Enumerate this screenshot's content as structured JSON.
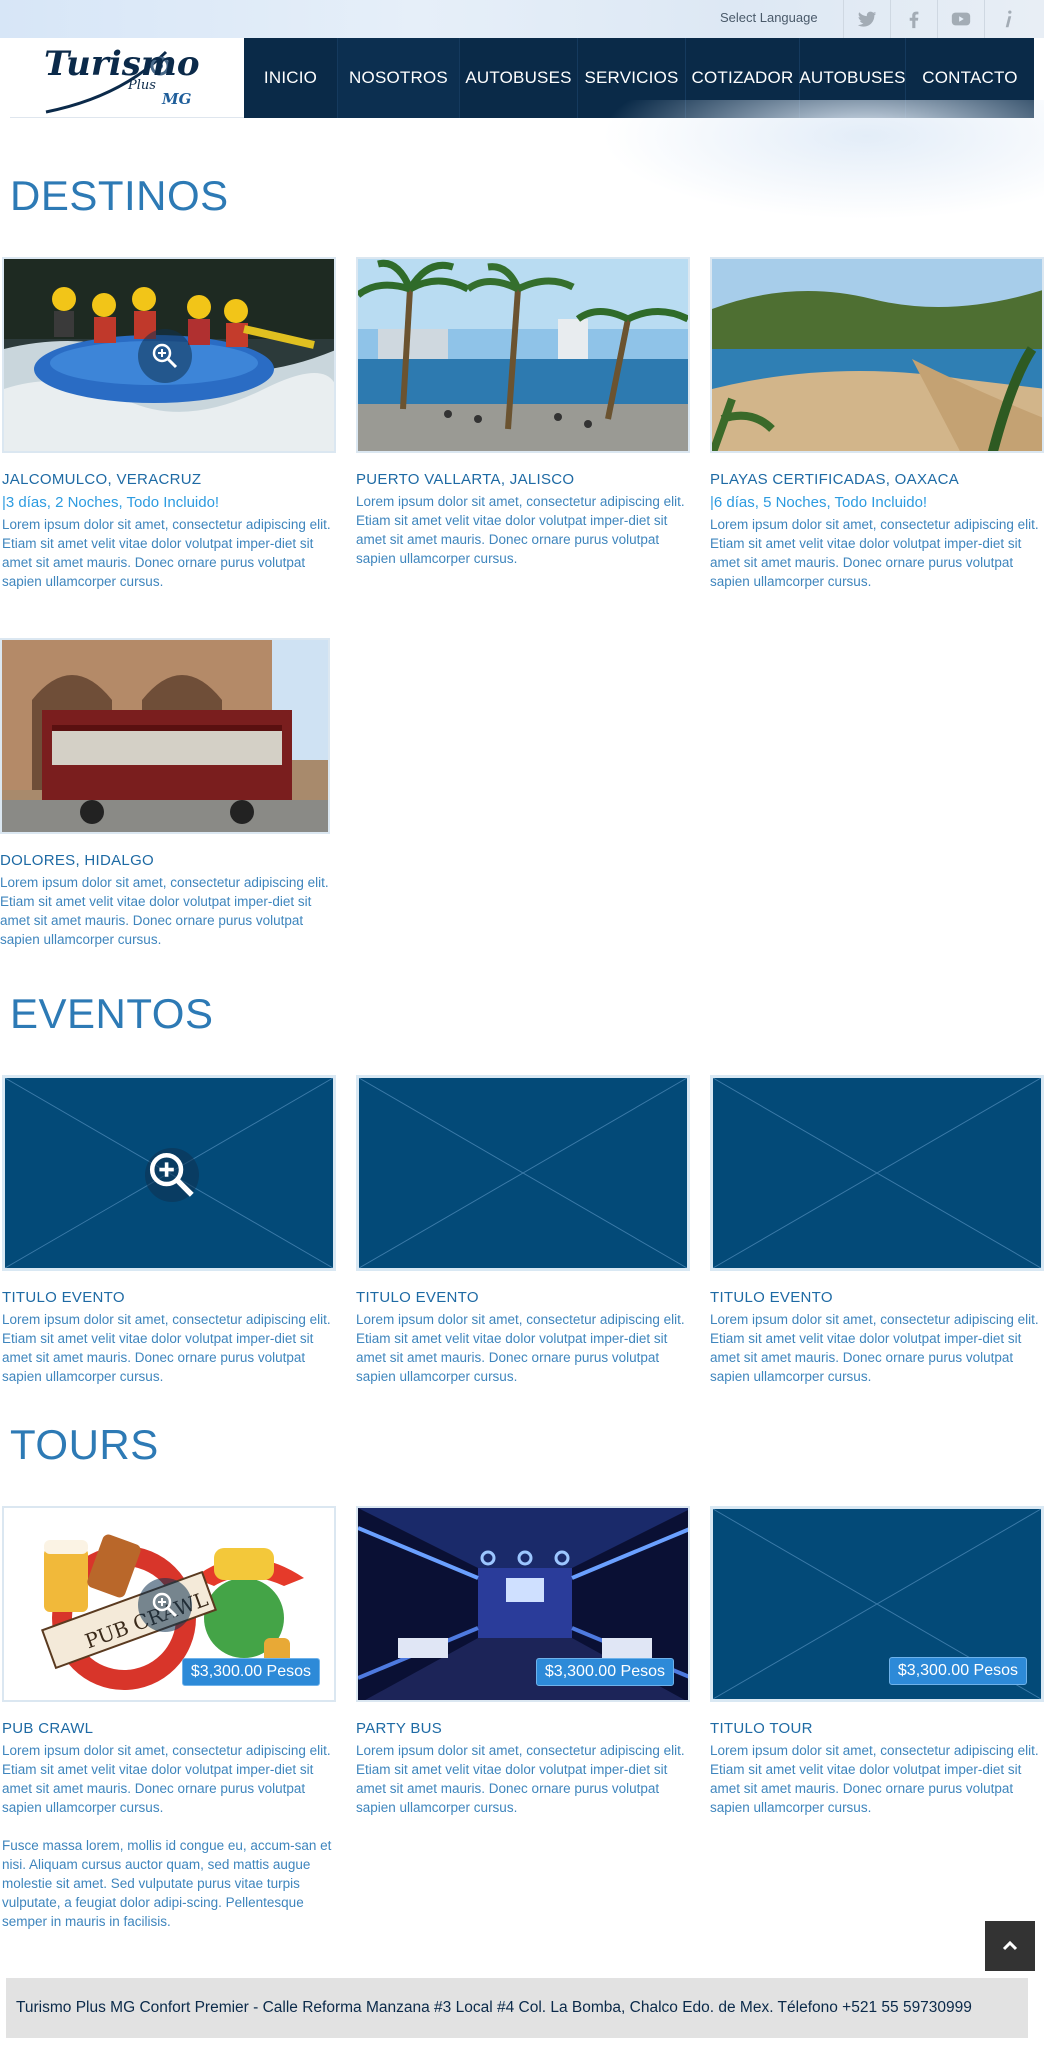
{
  "topbar": {
    "language_label": "Select Language",
    "social_icons": [
      "twitter-icon",
      "facebook-icon",
      "youtube-icon",
      "info-icon"
    ]
  },
  "logo": {
    "title": "Turismo",
    "plus": "Plus",
    "mg": "MG"
  },
  "nav": {
    "items": [
      {
        "label": "INICIO"
      },
      {
        "label": "NOSOTROS"
      },
      {
        "label": "AUTOBUSES"
      },
      {
        "label": "SERVICIOS"
      },
      {
        "label": "COTIZADOR"
      },
      {
        "label": "AUTOBUSES"
      },
      {
        "label": "CONTACTO"
      }
    ]
  },
  "destinos": {
    "title": "DESTINOS",
    "cards": [
      {
        "title": "JALCOMULCO, VERACRUZ",
        "subtitle": "|3 días, 2 Noches, Todo Incluido!",
        "text": "Lorem ipsum dolor sit amet, consectetur adipiscing elit. Etiam sit amet velit vitae dolor volutpat imper-diet sit amet sit amet mauris. Donec ornare purus volutpat sapien ullamcorper cursus."
      },
      {
        "title": "PUERTO VALLARTA, JALISCO",
        "text": "Lorem ipsum dolor sit amet, consectetur adipiscing elit. Etiam sit amet velit vitae dolor volutpat imper-diet sit amet sit amet mauris. Donec ornare purus volutpat sapien ullamcorper cursus."
      },
      {
        "title": "PLAYAS CERTIFICADAS, OAXACA",
        "subtitle": "|6 días, 5 Noches, Todo Incluido!",
        "text": "Lorem ipsum dolor sit amet, consectetur adipiscing elit. Etiam sit amet velit vitae dolor volutpat imper-diet sit amet sit amet mauris. Donec ornare purus volutpat sapien ullamcorper cursus."
      },
      {
        "title": "DOLORES, HIDALGO",
        "text": "Lorem ipsum dolor sit amet, consectetur adipiscing elit. Etiam sit amet velit vitae dolor volutpat imper-diet sit amet sit amet mauris. Donec ornare purus volutpat sapien ullamcorper cursus."
      }
    ]
  },
  "eventos": {
    "title": "EVENTOS",
    "cards": [
      {
        "title": "TITULO EVENTO",
        "text": "Lorem ipsum dolor sit amet, consectetur adipiscing elit. Etiam sit amet velit vitae dolor volutpat imper-diet sit amet sit amet mauris. Donec ornare purus volutpat sapien ullamcorper cursus."
      },
      {
        "title": "TITULO EVENTO",
        "text": "Lorem ipsum dolor sit amet, consectetur adipiscing elit. Etiam sit amet velit vitae dolor volutpat imper-diet sit amet sit amet mauris. Donec ornare purus volutpat sapien ullamcorper cursus."
      },
      {
        "title": "TITULO EVENTO",
        "text": "Lorem ipsum dolor sit amet, consectetur adipiscing elit. Etiam sit amet velit vitae dolor volutpat imper-diet sit amet sit amet mauris. Donec ornare purus volutpat sapien ullamcorper cursus."
      }
    ]
  },
  "tours": {
    "title": "TOURS",
    "cards": [
      {
        "title": "PUB CRAWL",
        "price": "$3,300.00 Pesos",
        "image_text": "PUB CRAWL",
        "text": "Lorem ipsum dolor sit amet, consectetur adipiscing elit. Etiam sit amet velit vitae dolor volutpat imper-diet sit amet sit amet mauris. Donec ornare purus volutpat sapien ullamcorper cursus.",
        "text2": "Fusce massa lorem, mollis id congue eu, accum-san et nisi. Aliquam cursus auctor quam, sed mattis augue molestie sit amet. Sed vulputate purus vitae turpis vulputate, a feugiat dolor adipi-scing. Pellentesque semper in mauris in facilisis."
      },
      {
        "title": "PARTY BUS",
        "price": "$3,300.00 Pesos",
        "text": "Lorem ipsum dolor sit amet, consectetur adipiscing elit. Etiam sit amet velit vitae dolor volutpat imper-diet sit amet sit amet mauris. Donec ornare purus volutpat sapien ullamcorper cursus."
      },
      {
        "title": "TITULO TOUR",
        "price": "$3,300.00 Pesos",
        "text": "Lorem ipsum dolor sit amet, consectetur adipiscing elit. Etiam sit amet velit vitae dolor volutpat imper-diet sit amet sit amet mauris. Donec ornare purus volutpat sapien ullamcorper cursus."
      }
    ]
  },
  "footer": {
    "text": "Turismo Plus MG Confort Premier - Calle Reforma Manzana #3 Local #4 Col. La Bomba, Chalco Edo. de Mex. Télefono +521 55 59730999"
  },
  "colors": {
    "nav_bg": "#0a2a48",
    "heading": "#2d7ab5",
    "placeholder": "#034a78",
    "price_badge": "#2d8ad8"
  }
}
